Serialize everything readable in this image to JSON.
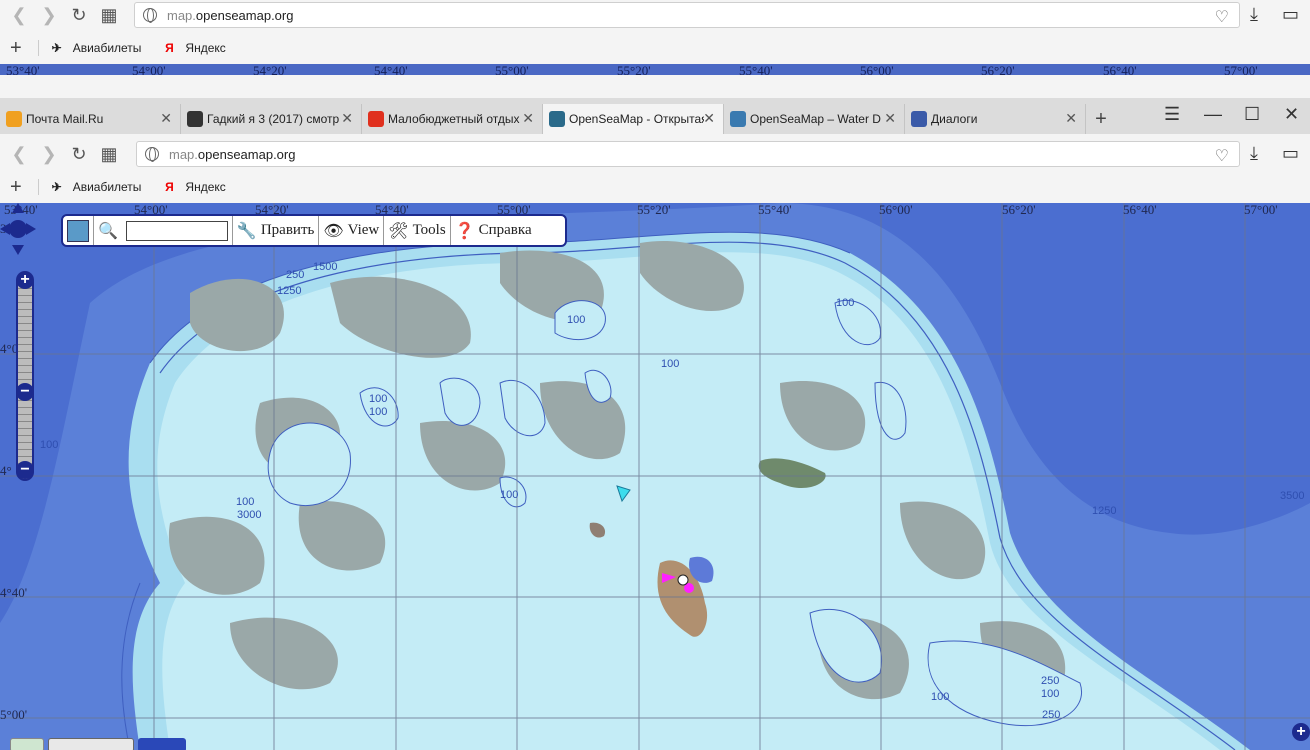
{
  "top_window": {
    "url_prefix": "map.",
    "url_host": "openseamap.org",
    "bookmarks": [
      {
        "label": "Авиабилеты",
        "icon": "airplane-icon"
      },
      {
        "label": "Яндекс",
        "icon": "yandex-icon"
      }
    ],
    "lon_ticks": [
      "53°40'",
      "54°00'",
      "54°20'",
      "54°40'",
      "55°00'",
      "55°20'",
      "55°40'",
      "56°00'",
      "56°20'",
      "56°40'",
      "57°00'"
    ]
  },
  "tabs": [
    {
      "title": "Почта Mail.Ru",
      "color": "#f0a020"
    },
    {
      "title": "Гадкий я 3 (2017) смотр",
      "color": "#333333"
    },
    {
      "title": "Малобюджетный отдых",
      "color": "#e0301e"
    },
    {
      "title": "OpenSeaMap - Открытая",
      "color": "#2a6a8a",
      "active": true
    },
    {
      "title": "OpenSeaMap – Water D",
      "color": "#3a7ab0"
    },
    {
      "title": "Диалоги",
      "color": "#3a5aa8"
    }
  ],
  "browser": {
    "url_prefix": "map.",
    "url_host": "openseamap.org",
    "bookmarks": [
      {
        "label": "Авиабилеты",
        "icon": "airplane-icon"
      },
      {
        "label": "Яндекс",
        "icon": "yandex-icon"
      }
    ]
  },
  "map": {
    "lon_ticks": [
      "53°40'",
      "54°00'",
      "54°20'",
      "54°40'",
      "55°00'",
      "55°20'",
      "55°40'",
      "56°00'",
      "56°20'",
      "56°40'",
      "57°00'"
    ],
    "lat_ticks": [
      "3°",
      "4°00'",
      "4°",
      "4°40'",
      "5°00'"
    ],
    "depth_labels": [
      "250",
      "1500",
      "1250",
      "100",
      "100",
      "100",
      "100",
      "100",
      "100",
      "100",
      "3000",
      "100",
      "100",
      "250",
      "250",
      "100",
      "1250",
      "3500"
    ],
    "toolbar": {
      "edit_label": "Править",
      "view_label": "View",
      "tools_label": "Tools",
      "help_label": "Справка",
      "search_placeholder": ""
    },
    "colors": {
      "deep": "#3f63c9",
      "mid": "#6a8fdc",
      "shelf": "#a9def0",
      "land": "#9aa8a8"
    }
  }
}
